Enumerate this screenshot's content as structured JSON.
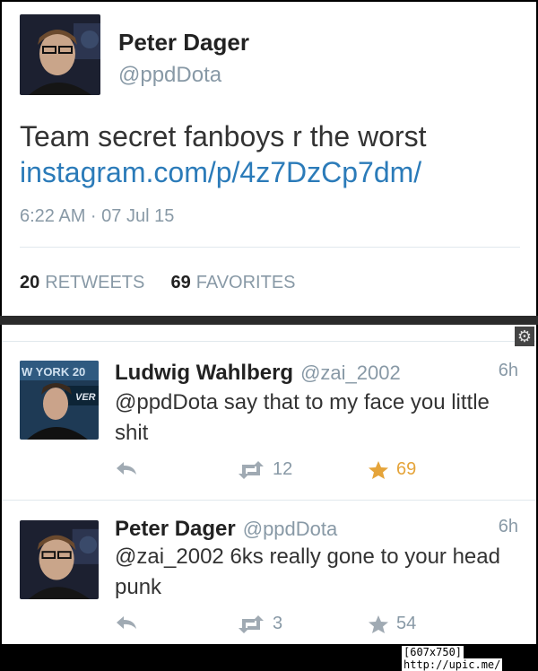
{
  "main_tweet": {
    "name": "Peter Dager",
    "handle": "@ppdDota",
    "text": "Team secret fanboys r the worst",
    "link": "instagram.com/p/4z7DzCp7dm/",
    "time": "6:22 AM · 07 Jul 15",
    "retweets_count": "20",
    "retweets_label": "RETWEETS",
    "favorites_count": "69",
    "favorites_label": "FAVORITES"
  },
  "replies": [
    {
      "name": "Ludwig Wahlberg",
      "handle": "@zai_2002",
      "time": "6h",
      "text": "@ppdDota say that to my face you little shit",
      "retweets": "12",
      "favorites": "69",
      "avatar_banner_text": "W YORK 20",
      "avatar_sub_text": "VER"
    },
    {
      "name": "Peter Dager",
      "handle": "@ppdDota",
      "time": "6h",
      "text": "@zai_2002 6ks really gone to your head punk",
      "retweets": "3",
      "favorites": "54"
    }
  ],
  "footer": {
    "size_label": "[607x750]",
    "site": "http://upic.me/"
  },
  "colors": {
    "link": "#2b7bb9",
    "muted": "#8899a6",
    "favorite_active": "#e5a43a"
  }
}
